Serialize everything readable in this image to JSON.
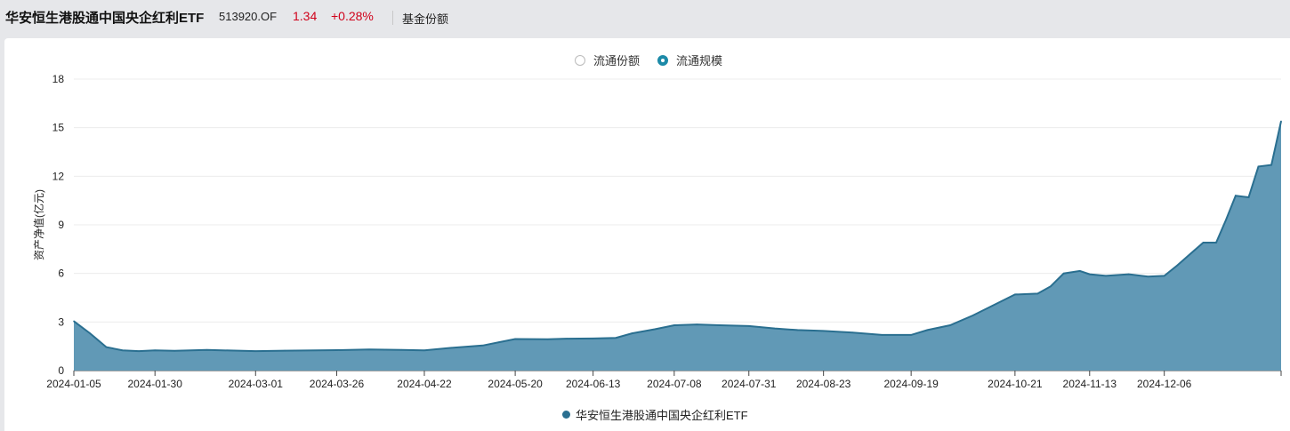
{
  "header": {
    "fund_name": "华安恒生港股通中国央企红利ETF",
    "fund_code": "513920.OF",
    "price": "1.34",
    "change": "+0.28%",
    "tab_label": "基金份额"
  },
  "toggle": {
    "options": [
      "流通份额",
      "流通规模"
    ],
    "selected": "流通规模"
  },
  "colors": {
    "series_line": "#2a6f90",
    "series_fill": "#6199b6",
    "accent": "#1c8aa8",
    "price_up": "#d0021b"
  },
  "chart_data": {
    "type": "area",
    "title": "",
    "ylabel": "资产净值(亿元)",
    "xlabel": "",
    "ylim": [
      0,
      18
    ],
    "yticks": [
      0,
      3,
      6,
      9,
      12,
      15,
      18
    ],
    "xticks": [
      "2024-01-05",
      "2024-01-30",
      "2024-03-01",
      "2024-03-26",
      "2024-04-22",
      "2024-05-20",
      "2024-06-13",
      "2024-07-08",
      "2024-07-31",
      "2024-08-23",
      "2024-09-19",
      "2024-10-21",
      "2024-11-13",
      "2024-12-06"
    ],
    "grid": true,
    "legend_position": "bottom",
    "series": [
      {
        "name": "华安恒生港股通中国央企红利ETF",
        "points": [
          [
            "2024-01-05",
            3.05
          ],
          [
            "2024-01-10",
            2.3
          ],
          [
            "2024-01-15",
            1.45
          ],
          [
            "2024-01-20",
            1.25
          ],
          [
            "2024-01-25",
            1.2
          ],
          [
            "2024-01-30",
            1.25
          ],
          [
            "2024-02-05",
            1.22
          ],
          [
            "2024-02-15",
            1.28
          ],
          [
            "2024-02-22",
            1.24
          ],
          [
            "2024-03-01",
            1.2
          ],
          [
            "2024-03-10",
            1.23
          ],
          [
            "2024-03-26",
            1.26
          ],
          [
            "2024-04-05",
            1.3
          ],
          [
            "2024-04-15",
            1.28
          ],
          [
            "2024-04-22",
            1.25
          ],
          [
            "2024-04-30",
            1.4
          ],
          [
            "2024-05-10",
            1.55
          ],
          [
            "2024-05-15",
            1.75
          ],
          [
            "2024-05-20",
            1.95
          ],
          [
            "2024-05-30",
            1.93
          ],
          [
            "2024-06-05",
            1.97
          ],
          [
            "2024-06-13",
            1.98
          ],
          [
            "2024-06-20",
            2.02
          ],
          [
            "2024-06-25",
            2.3
          ],
          [
            "2024-07-02",
            2.55
          ],
          [
            "2024-07-08",
            2.8
          ],
          [
            "2024-07-15",
            2.85
          ],
          [
            "2024-07-22",
            2.8
          ],
          [
            "2024-07-31",
            2.75
          ],
          [
            "2024-08-08",
            2.6
          ],
          [
            "2024-08-15",
            2.5
          ],
          [
            "2024-08-23",
            2.45
          ],
          [
            "2024-09-01",
            2.35
          ],
          [
            "2024-09-10",
            2.2
          ],
          [
            "2024-09-19",
            2.2
          ],
          [
            "2024-09-24",
            2.5
          ],
          [
            "2024-10-01",
            2.8
          ],
          [
            "2024-10-08",
            3.4
          ],
          [
            "2024-10-14",
            4.0
          ],
          [
            "2024-10-21",
            4.7
          ],
          [
            "2024-10-28",
            4.75
          ],
          [
            "2024-11-01",
            5.2
          ],
          [
            "2024-11-05",
            6.0
          ],
          [
            "2024-11-10",
            6.15
          ],
          [
            "2024-11-13",
            5.95
          ],
          [
            "2024-11-18",
            5.85
          ],
          [
            "2024-11-25",
            5.95
          ],
          [
            "2024-12-01",
            5.8
          ],
          [
            "2024-12-06",
            5.85
          ],
          [
            "2024-12-10",
            6.5
          ],
          [
            "2024-12-14",
            7.2
          ],
          [
            "2024-12-18",
            7.9
          ],
          [
            "2024-12-22",
            7.9
          ],
          [
            "2024-12-25",
            9.3
          ],
          [
            "2024-12-28",
            10.8
          ],
          [
            "2025-01-01",
            10.7
          ],
          [
            "2025-01-04",
            12.6
          ],
          [
            "2025-01-08",
            12.7
          ],
          [
            "2025-01-11",
            15.4
          ]
        ]
      }
    ]
  }
}
